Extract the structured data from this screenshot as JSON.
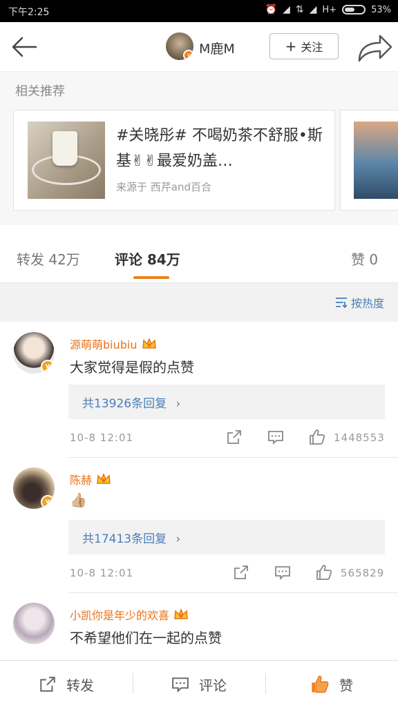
{
  "status_bar": {
    "time": "下午2:25",
    "network": "H+",
    "battery": "53%"
  },
  "navbar": {
    "user_name": "M鹿M",
    "follow_label": "关注"
  },
  "related": {
    "section_title": "相关推荐",
    "card": {
      "text": "#关晓彤# 不喝奶茶不舒服•斯基✌✌最爱奶盖…",
      "source": "来源于 西芹and百合"
    }
  },
  "tabs": {
    "repost": "转发 42万",
    "comment": "评论 84万",
    "like": "赞 0"
  },
  "sort_label": "按热度",
  "comments": [
    {
      "name": "源萌萌biubiu",
      "text": "大家觉得是假的点赞",
      "replies": "共13926条回复",
      "time": "10-8 12:01",
      "likes": "1448553"
    },
    {
      "name": "陈赫",
      "text": "👍🏼",
      "replies": "共17413条回复",
      "time": "10-8 12:01",
      "likes": "565829"
    },
    {
      "name": "小凯你是年少的欢喜",
      "text": "不希望他们在一起的点赞"
    }
  ],
  "bottom_bar": {
    "repost": "转发",
    "comment": "评论",
    "like": "赞"
  },
  "colors": {
    "accent": "#f07f19",
    "link": "#4a7eb8",
    "username": "#e8731a"
  }
}
